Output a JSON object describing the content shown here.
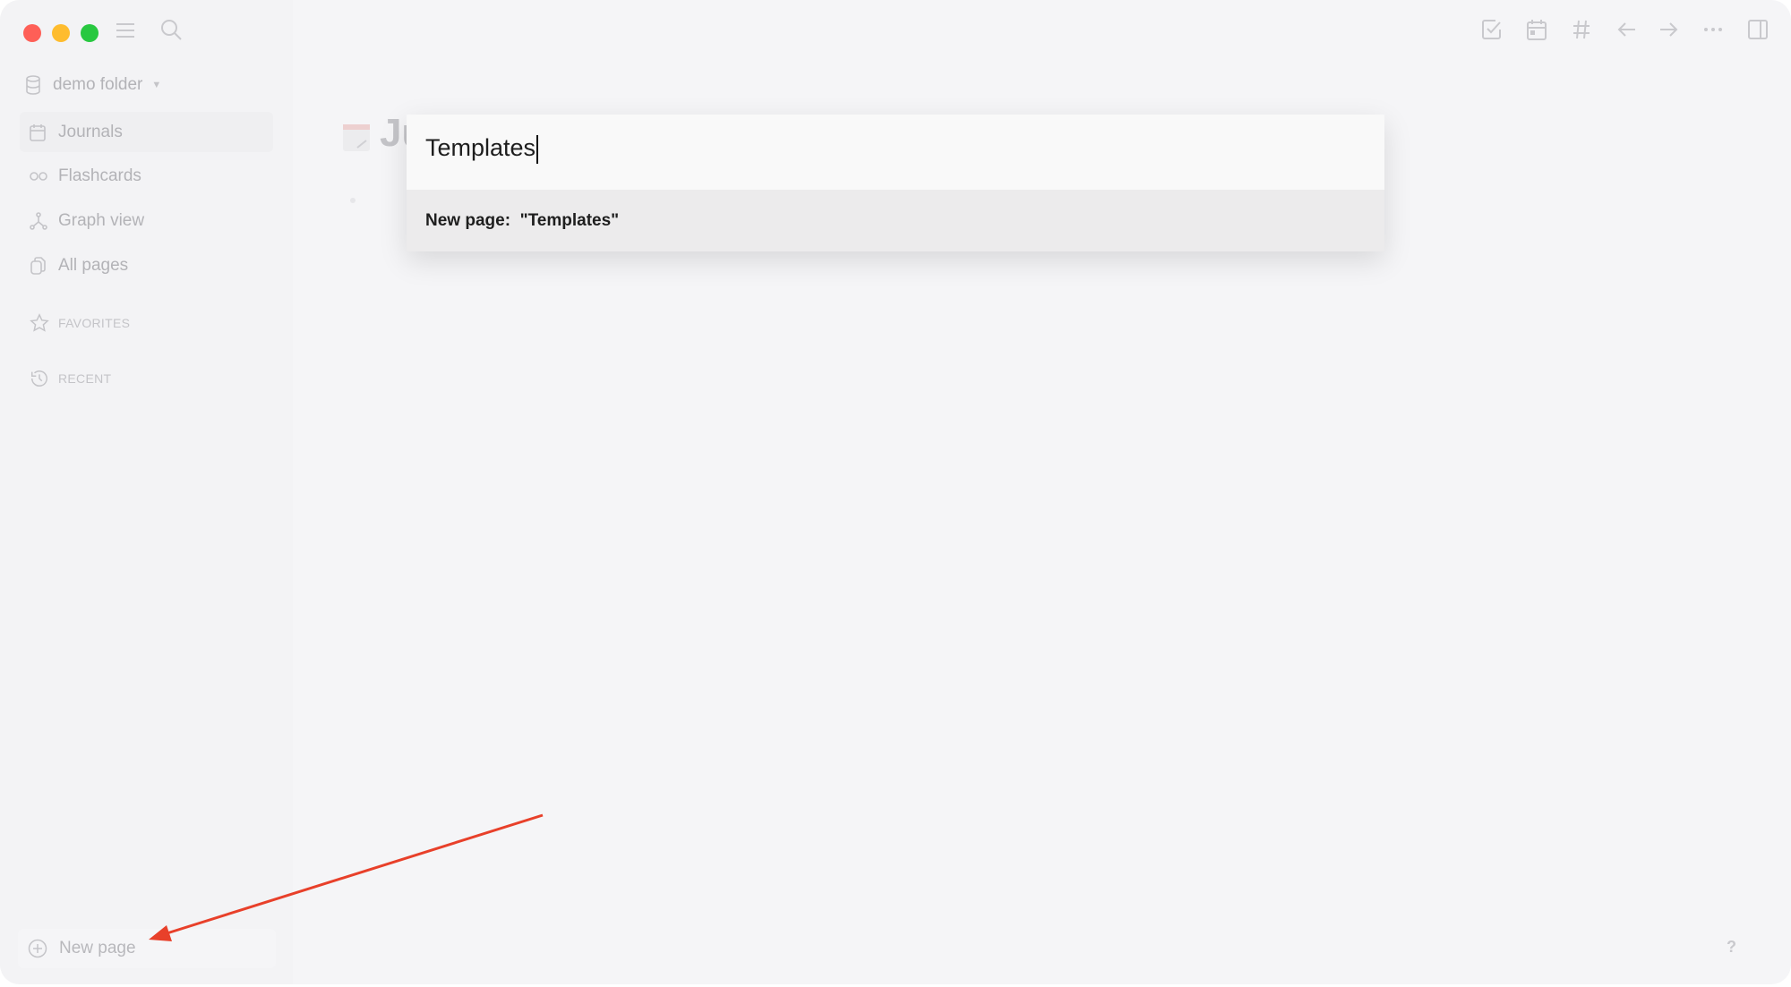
{
  "sidebar": {
    "workspace": "demo folder",
    "items": [
      {
        "label": "Journals",
        "icon": "calendar-icon",
        "active": true
      },
      {
        "label": "Flashcards",
        "icon": "infinity-icon"
      },
      {
        "label": "Graph view",
        "icon": "graph-icon"
      },
      {
        "label": "All pages",
        "icon": "pages-icon"
      }
    ],
    "favorites_label": "FAVORITES",
    "recent_label": "RECENT",
    "new_page_label": "New page"
  },
  "main": {
    "title_partial": "Ju"
  },
  "search": {
    "value": "Templates",
    "result_label": "New page:  \"Templates\""
  },
  "help_label": "?",
  "colors": {
    "annotation_arrow": "#e8402a",
    "close": "#fe5f57",
    "minimize": "#febc2e",
    "maximize": "#28c840"
  }
}
